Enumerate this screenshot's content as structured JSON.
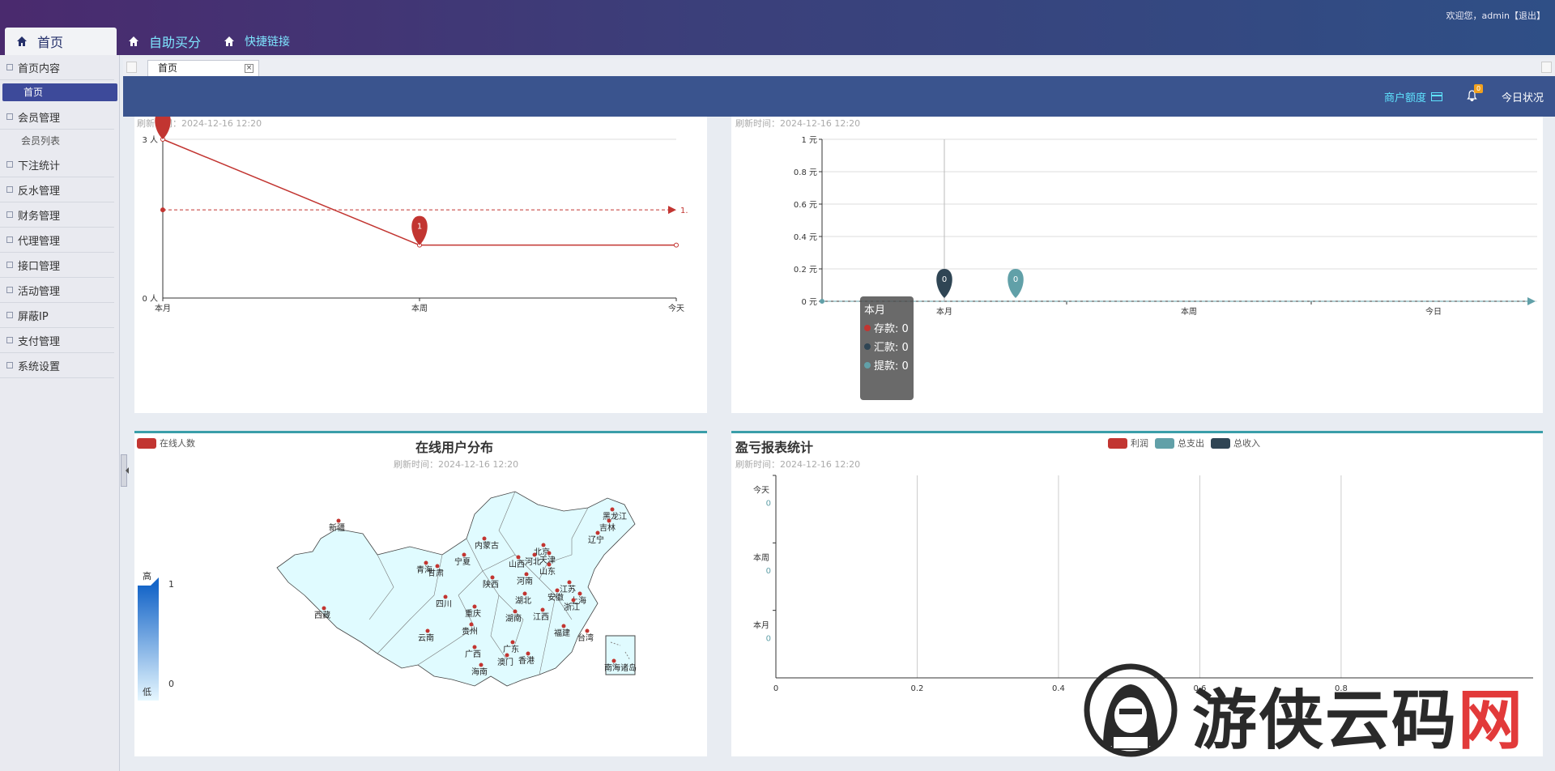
{
  "header": {
    "welcome": "欢迎您，admin【退出】",
    "nav": [
      {
        "label": "首页"
      },
      {
        "label": "自助买分"
      },
      {
        "label": "快捷链接"
      }
    ]
  },
  "sidebar": {
    "groups": [
      {
        "label": "首页内容",
        "items": [
          "首页"
        ]
      },
      {
        "label": "会员管理",
        "items": [
          "会员列表"
        ]
      },
      {
        "label": "下注统计",
        "items": []
      },
      {
        "label": "反水管理",
        "items": []
      },
      {
        "label": "财务管理",
        "items": []
      },
      {
        "label": "代理管理",
        "items": []
      },
      {
        "label": "接口管理",
        "items": []
      },
      {
        "label": "活动管理",
        "items": []
      },
      {
        "label": "屏蔽IP",
        "items": []
      },
      {
        "label": "支付管理",
        "items": []
      },
      {
        "label": "系统设置",
        "items": []
      }
    ],
    "active_item": "首页"
  },
  "tabs": [
    {
      "label": "首页"
    }
  ],
  "toolbar": {
    "quota_label": "商户额度",
    "bell_badge": "0",
    "today_label": "今日状况"
  },
  "colors": {
    "red": "#c23531",
    "dark": "#2f4554",
    "teal": "#61a0a8",
    "header_accent": "#3a548e"
  },
  "panel_users": {
    "subtitle": "刷新时间：2024-12-16 12:20",
    "chart_data": {
      "type": "line",
      "categories": [
        "本月",
        "本周",
        "今天"
      ],
      "values": [
        3,
        1,
        1
      ],
      "y_tick_labels": [
        "3 人",
        "0 人"
      ],
      "ylim": [
        0,
        3
      ],
      "markpoint_label": "1",
      "markline_label": "1."
    }
  },
  "panel_finance": {
    "subtitle": "刷新时间：2024-12-16 12:20",
    "chart_data": {
      "type": "line",
      "categories": [
        "本月",
        "本周",
        "今日"
      ],
      "y_tick_labels": [
        "1 元",
        "0.8 元",
        "0.6 元",
        "0.4 元",
        "0.2 元",
        "0 元"
      ],
      "ylim": [
        0,
        1
      ],
      "series": [
        {
          "name": "存款",
          "values": [
            0,
            0,
            0
          ]
        },
        {
          "name": "汇款",
          "values": [
            0,
            0,
            0
          ]
        },
        {
          "name": "提款",
          "values": [
            0,
            0,
            0
          ]
        }
      ],
      "markpoint_labels": [
        "0",
        "0"
      ]
    },
    "tooltip": {
      "title": "本月",
      "rows": [
        {
          "label": "存款: 0",
          "color": "#c23531"
        },
        {
          "label": "汇款: 0",
          "color": "#2f4554"
        },
        {
          "label": "提款: 0",
          "color": "#61a0a8"
        }
      ]
    }
  },
  "panel_map": {
    "title": "在线用户分布",
    "subtitle": "刷新时间：2024-12-16 12:20",
    "legend": "在线人数",
    "scale_high": "高",
    "scale_low": "低",
    "scale_max": "1",
    "scale_min": "0",
    "provinces": [
      "新疆",
      "西藏",
      "内蒙古",
      "黑龙江",
      "吉林",
      "辽宁",
      "北京",
      "天津",
      "河北",
      "山西",
      "山东",
      "宁夏",
      "青海",
      "甘肃",
      "陕西",
      "河南",
      "江苏",
      "安徽",
      "上海",
      "浙江",
      "湖北",
      "四川",
      "重庆",
      "湖南",
      "江西",
      "贵州",
      "云南",
      "广西",
      "广东",
      "福建",
      "台湾",
      "香港",
      "澳门",
      "海南",
      "南海诸岛"
    ]
  },
  "panel_profit": {
    "title": "盈亏报表统计",
    "subtitle": "刷新时间：2024-12-16 12:20",
    "chart_data": {
      "type": "bar",
      "orientation": "horizontal",
      "categories": [
        "今天",
        "本周",
        "本月"
      ],
      "series": [
        {
          "name": "利润",
          "values": [
            0,
            0,
            0
          ]
        },
        {
          "name": "总支出",
          "values": [
            0,
            0,
            0
          ]
        },
        {
          "name": "总收入",
          "values": [
            0,
            0,
            0
          ]
        }
      ],
      "x_tick_labels": [
        "0",
        "0.2",
        "0.4",
        "0.6",
        "0.8"
      ],
      "value_labels": [
        "0",
        "0",
        "0"
      ]
    }
  },
  "watermark": {
    "text_black": "游侠云码",
    "text_red": "网"
  }
}
